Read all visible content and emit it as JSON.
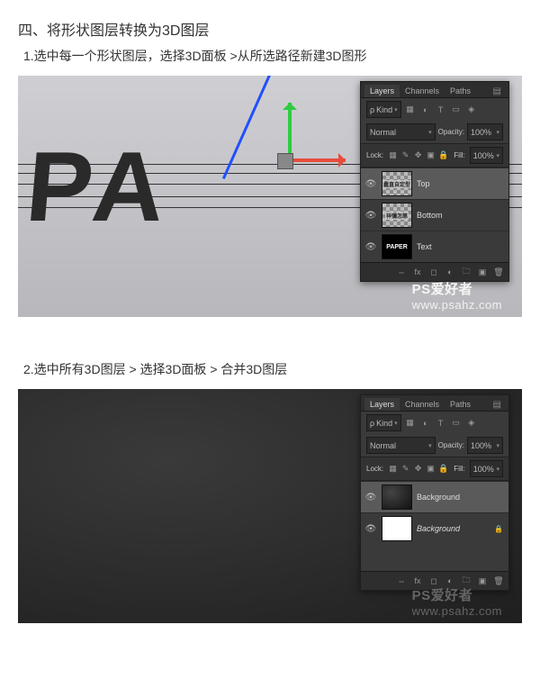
{
  "doc": {
    "heading4": "四、将形状图层转换为3D图层",
    "step1": "1.选中每一个形状图层，选择3D面板 >从所选路径新建3D图形",
    "step2": "2.选中所有3D图层 > 选择3D面板 > 合并3D图层"
  },
  "panel": {
    "tabs": {
      "layers": "Layers",
      "channels": "Channels",
      "paths": "Paths"
    },
    "kind": "Kind",
    "mode": "Normal",
    "opacity_label": "Opacity:",
    "opacity_value": "100%",
    "lock_label": "Lock:",
    "fill_label": "Fill:",
    "fill_value": "100%",
    "filter_icons": [
      "img",
      "adj",
      "T",
      "shp",
      "fx"
    ]
  },
  "screenshot1": {
    "word": "PA",
    "layers": [
      {
        "name": "Top",
        "thumb_text": "蠢直自定型"
      },
      {
        "name": "Bottom",
        "thumb_text": "祥彌怎慈"
      },
      {
        "name": "Text",
        "thumb_text": "PAPER"
      }
    ]
  },
  "screenshot2": {
    "layers": [
      {
        "name": "Background"
      },
      {
        "name": "Background"
      }
    ]
  },
  "watermark": {
    "brand": "PS爱好者",
    "url": "www.psahz.com"
  }
}
